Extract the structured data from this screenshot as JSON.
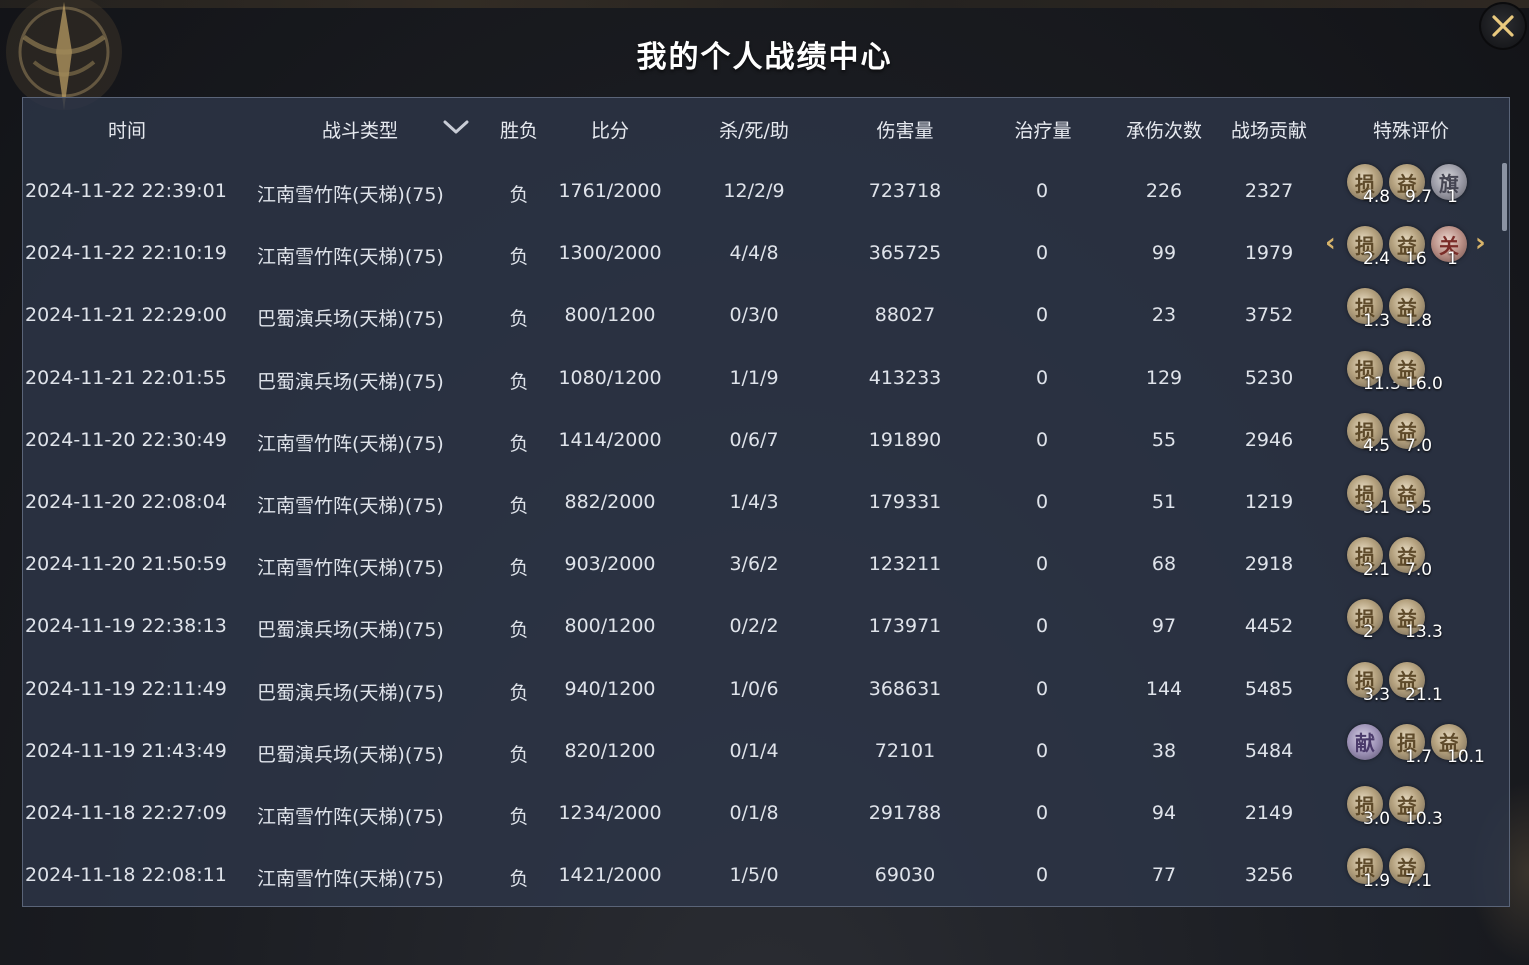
{
  "title": "我的个人战绩中心",
  "columns": {
    "time": "时间",
    "type": "战斗类型",
    "result": "胜负",
    "score": "比分",
    "kda": "杀/死/助",
    "damage": "伤害量",
    "heal": "治疗量",
    "hits": "承伤次数",
    "contribution": "战场贡献",
    "rating": "特殊评价"
  },
  "icons": {
    "close": "close-icon",
    "filter": "chevron-down-icon",
    "emblem": "emblem-icon"
  },
  "rows": [
    {
      "time": "2024-11-22 22:39:01",
      "type": "江南雪竹阵(天梯)(75)",
      "result": "负",
      "score": "1761/2000",
      "kda": "12/2/9",
      "damage": "723718",
      "heal": "0",
      "hits": "226",
      "contribution": "2327",
      "badges": [
        {
          "glyph": "损",
          "style": "gold",
          "value": "4.8"
        },
        {
          "glyph": "益",
          "style": "gold",
          "value": "9.7"
        },
        {
          "glyph": "旗",
          "style": "grey",
          "value": "1"
        }
      ],
      "arrows": false
    },
    {
      "time": "2024-11-22 22:10:19",
      "type": "江南雪竹阵(天梯)(75)",
      "result": "负",
      "score": "1300/2000",
      "kda": "4/4/8",
      "damage": "365725",
      "heal": "0",
      "hits": "99",
      "contribution": "1979",
      "badges": [
        {
          "glyph": "损",
          "style": "gold",
          "value": "2.4"
        },
        {
          "glyph": "益",
          "style": "gold",
          "value": "16"
        },
        {
          "glyph": "关",
          "style": "red",
          "value": "1"
        }
      ],
      "arrows": true
    },
    {
      "time": "2024-11-21 22:29:00",
      "type": "巴蜀演兵场(天梯)(75)",
      "result": "负",
      "score": "800/1200",
      "kda": "0/3/0",
      "damage": "88027",
      "heal": "0",
      "hits": "23",
      "contribution": "3752",
      "badges": [
        {
          "glyph": "损",
          "style": "gold",
          "value": "1.3"
        },
        {
          "glyph": "益",
          "style": "gold",
          "value": "1.8"
        }
      ],
      "arrows": false
    },
    {
      "time": "2024-11-21 22:01:55",
      "type": "巴蜀演兵场(天梯)(75)",
      "result": "负",
      "score": "1080/1200",
      "kda": "1/1/9",
      "damage": "413233",
      "heal": "0",
      "hits": "129",
      "contribution": "5230",
      "badges": [
        {
          "glyph": "损",
          "style": "gold",
          "value": "11.3"
        },
        {
          "glyph": "益",
          "style": "gold",
          "value": "16.0"
        }
      ],
      "arrows": false
    },
    {
      "time": "2024-11-20 22:30:49",
      "type": "江南雪竹阵(天梯)(75)",
      "result": "负",
      "score": "1414/2000",
      "kda": "0/6/7",
      "damage": "191890",
      "heal": "0",
      "hits": "55",
      "contribution": "2946",
      "badges": [
        {
          "glyph": "损",
          "style": "gold",
          "value": "4.5"
        },
        {
          "glyph": "益",
          "style": "gold",
          "value": "7.0"
        }
      ],
      "arrows": false
    },
    {
      "time": "2024-11-20 22:08:04",
      "type": "江南雪竹阵(天梯)(75)",
      "result": "负",
      "score": "882/2000",
      "kda": "1/4/3",
      "damage": "179331",
      "heal": "0",
      "hits": "51",
      "contribution": "1219",
      "badges": [
        {
          "glyph": "损",
          "style": "gold",
          "value": "3.1"
        },
        {
          "glyph": "益",
          "style": "gold",
          "value": "5.5"
        }
      ],
      "arrows": false
    },
    {
      "time": "2024-11-20 21:50:59",
      "type": "江南雪竹阵(天梯)(75)",
      "result": "负",
      "score": "903/2000",
      "kda": "3/6/2",
      "damage": "123211",
      "heal": "0",
      "hits": "68",
      "contribution": "2918",
      "badges": [
        {
          "glyph": "损",
          "style": "gold",
          "value": "2.1"
        },
        {
          "glyph": "益",
          "style": "gold",
          "value": "7.0"
        }
      ],
      "arrows": false
    },
    {
      "time": "2024-11-19 22:38:13",
      "type": "巴蜀演兵场(天梯)(75)",
      "result": "负",
      "score": "800/1200",
      "kda": "0/2/2",
      "damage": "173971",
      "heal": "0",
      "hits": "97",
      "contribution": "4452",
      "badges": [
        {
          "glyph": "损",
          "style": "gold",
          "value": "2"
        },
        {
          "glyph": "益",
          "style": "gold",
          "value": "13.3"
        }
      ],
      "arrows": false
    },
    {
      "time": "2024-11-19 22:11:49",
      "type": "巴蜀演兵场(天梯)(75)",
      "result": "负",
      "score": "940/1200",
      "kda": "1/0/6",
      "damage": "368631",
      "heal": "0",
      "hits": "144",
      "contribution": "5485",
      "badges": [
        {
          "glyph": "损",
          "style": "gold",
          "value": "3.3"
        },
        {
          "glyph": "益",
          "style": "gold",
          "value": "21.1"
        }
      ],
      "arrows": false
    },
    {
      "time": "2024-11-19 21:43:49",
      "type": "巴蜀演兵场(天梯)(75)",
      "result": "负",
      "score": "820/1200",
      "kda": "0/1/4",
      "damage": "72101",
      "heal": "0",
      "hits": "38",
      "contribution": "5484",
      "badges": [
        {
          "glyph": "献",
          "style": "purple",
          "value": ""
        },
        {
          "glyph": "损",
          "style": "gold",
          "value": "1.7"
        },
        {
          "glyph": "益",
          "style": "gold",
          "value": "10.1"
        }
      ],
      "arrows": false
    },
    {
      "time": "2024-11-18 22:27:09",
      "type": "江南雪竹阵(天梯)(75)",
      "result": "负",
      "score": "1234/2000",
      "kda": "0/1/8",
      "damage": "291788",
      "heal": "0",
      "hits": "94",
      "contribution": "2149",
      "badges": [
        {
          "glyph": "损",
          "style": "gold",
          "value": "3.0"
        },
        {
          "glyph": "益",
          "style": "gold",
          "value": "10.3"
        }
      ],
      "arrows": false
    },
    {
      "time": "2024-11-18 22:08:11",
      "type": "江南雪竹阵(天梯)(75)",
      "result": "负",
      "score": "1421/2000",
      "kda": "1/5/0",
      "damage": "69030",
      "heal": "0",
      "hits": "77",
      "contribution": "3256",
      "badges": [
        {
          "glyph": "损",
          "style": "gold",
          "value": "1.9"
        },
        {
          "glyph": "益",
          "style": "gold",
          "value": "7.1"
        }
      ],
      "arrows": false
    }
  ]
}
